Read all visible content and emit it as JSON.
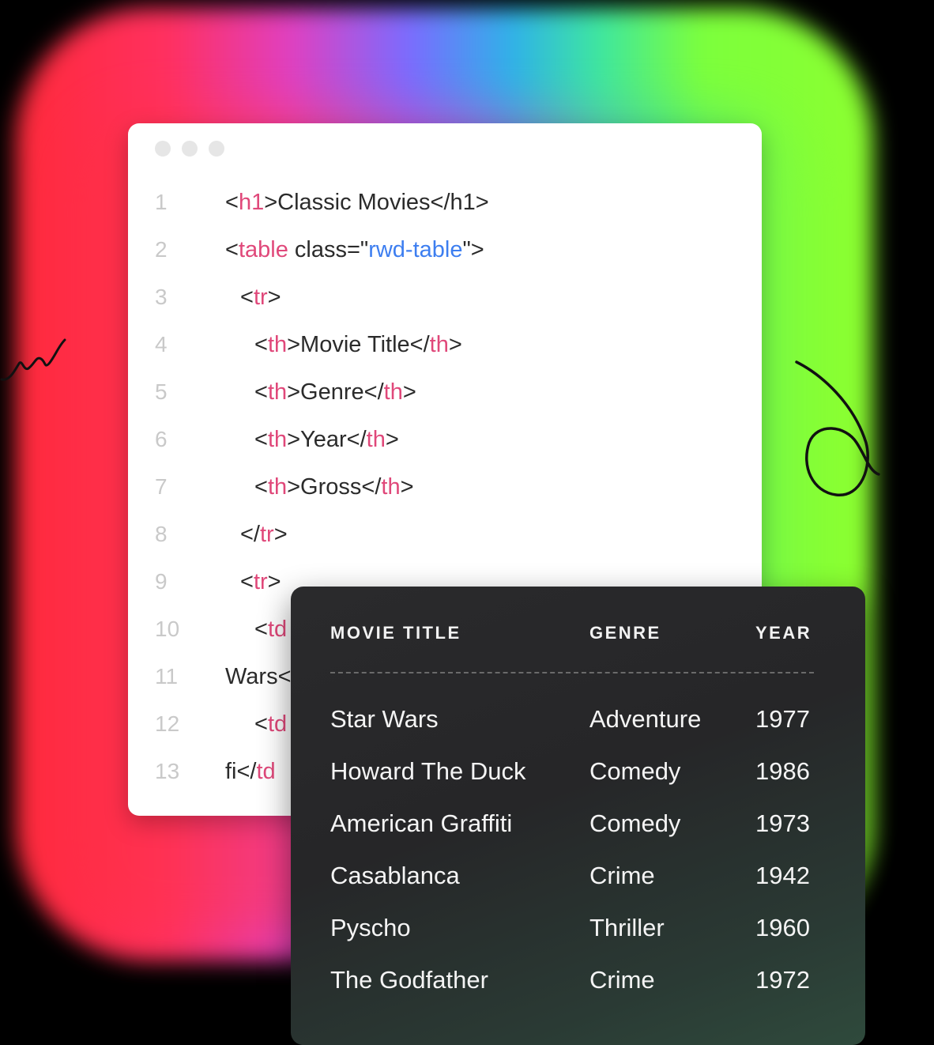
{
  "editor": {
    "lines": [
      {
        "num": "1",
        "segments": [
          [
            "",
            "<"
          ],
          [
            "tag",
            "h1"
          ],
          [
            "",
            ">Classic Movies</h1>"
          ]
        ]
      },
      {
        "num": "2",
        "segments": [
          [
            "",
            "<"
          ],
          [
            "tag",
            "table"
          ],
          [
            "",
            " class=\""
          ],
          [
            "attr-val",
            "rwd-table"
          ],
          [
            "",
            "\">"
          ]
        ]
      },
      {
        "num": "3",
        "segments": [
          [
            "",
            "<"
          ],
          [
            "tag",
            "tr"
          ],
          [
            "",
            ">"
          ]
        ]
      },
      {
        "num": "4",
        "segments": [
          [
            "",
            "<"
          ],
          [
            "tag",
            "th"
          ],
          [
            "",
            ">Movie Title</"
          ],
          [
            "tag",
            "th"
          ],
          [
            "",
            ">"
          ]
        ]
      },
      {
        "num": "5",
        "segments": [
          [
            "",
            "<"
          ],
          [
            "tag",
            "th"
          ],
          [
            "",
            ">Genre</"
          ],
          [
            "tag",
            "th"
          ],
          [
            "",
            ">"
          ]
        ]
      },
      {
        "num": "6",
        "segments": [
          [
            "",
            "<"
          ],
          [
            "tag",
            "th"
          ],
          [
            "",
            ">Year</"
          ],
          [
            "tag",
            "th"
          ],
          [
            "",
            ">"
          ]
        ]
      },
      {
        "num": "7",
        "segments": [
          [
            "",
            "<"
          ],
          [
            "tag",
            "th"
          ],
          [
            "",
            ">Gross</"
          ],
          [
            "tag",
            "th"
          ],
          [
            "",
            ">"
          ]
        ]
      },
      {
        "num": "8",
        "segments": [
          [
            "",
            "</"
          ],
          [
            "tag",
            "tr"
          ],
          [
            "",
            ">"
          ]
        ]
      },
      {
        "num": "9",
        "segments": [
          [
            "",
            "<"
          ],
          [
            "tag",
            "tr"
          ],
          [
            "",
            ">"
          ]
        ]
      },
      {
        "num": "10",
        "segments": [
          [
            "",
            "<"
          ],
          [
            "tag",
            "td"
          ]
        ]
      },
      {
        "num": "11",
        "segments": [
          [
            "",
            "Wars<"
          ]
        ]
      },
      {
        "num": "12",
        "segments": [
          [
            "",
            "<"
          ],
          [
            "tag",
            "td"
          ]
        ]
      },
      {
        "num": "13",
        "segments": [
          [
            "",
            "fi</"
          ],
          [
            "tag",
            "td"
          ]
        ]
      }
    ]
  },
  "table": {
    "headers": [
      "MOVIE TITLE",
      "GENRE",
      "YEAR"
    ],
    "rows": [
      [
        "Star Wars",
        "Adventure",
        "1977"
      ],
      [
        "Howard The Duck",
        "Comedy",
        "1986"
      ],
      [
        "American Graffiti",
        "Comedy",
        "1973"
      ],
      [
        "Casablanca",
        "Crime",
        "1942"
      ],
      [
        "Pyscho",
        "Thriller",
        "1960"
      ],
      [
        "The Godfather",
        "Crime",
        "1972"
      ]
    ]
  }
}
